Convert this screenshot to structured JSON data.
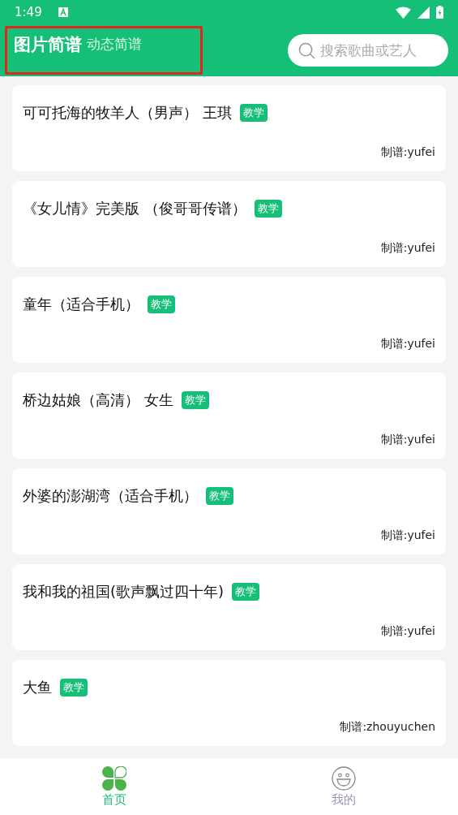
{
  "status_bar": {
    "time": "1:49"
  },
  "tabs": [
    {
      "label": "图片简谱",
      "selected": true
    },
    {
      "label": "动态简谱",
      "selected": false
    }
  ],
  "search": {
    "placeholder": "搜索歌曲或艺人"
  },
  "songs": [
    {
      "title": "可可托海的牧羊人（男声） 王琪",
      "tag": "教学",
      "author": "制谱:yufei"
    },
    {
      "title": "《女儿情》完美版 （俊哥哥传谱）",
      "tag": "教学",
      "author": "制谱:yufei"
    },
    {
      "title": "童年（适合手机）",
      "tag": "教学",
      "author": "制谱:yufei"
    },
    {
      "title": "桥边姑娘（高清） 女生",
      "tag": "教学",
      "author": "制谱:yufei"
    },
    {
      "title": "外婆的澎湖湾（适合手机）",
      "tag": "教学",
      "author": "制谱:yufei"
    },
    {
      "title": "我和我的祖国(歌声飘过四十年)",
      "tag": "教学",
      "author": "制谱:yufei"
    },
    {
      "title": "大鱼",
      "tag": "教学",
      "author": "制谱:zhouyuchen"
    }
  ],
  "bottom_nav": [
    {
      "label": "首页",
      "kind": "home",
      "selected": true
    },
    {
      "label": "我的",
      "kind": "profile",
      "selected": false
    }
  ]
}
